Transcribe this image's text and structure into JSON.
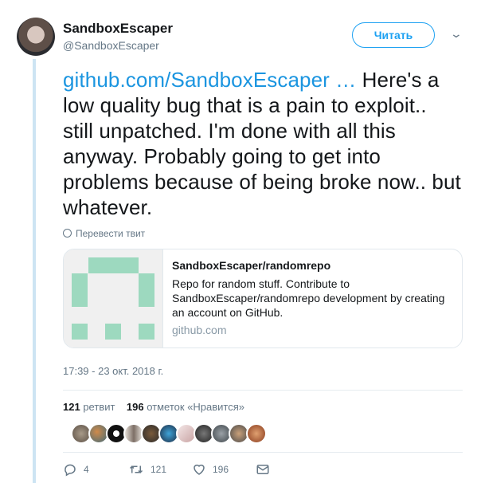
{
  "author": {
    "display_name": "SandboxEscaper",
    "handle": "@SandboxEscaper"
  },
  "follow_label": "Читать",
  "tweet": {
    "link_text": "github.com/SandboxEscaper …",
    "body": " Here's a low quality bug that is a pain to exploit.. still unpatched. I'm done with all this anyway. Probably going to get into problems because of being broke now.. but whatever.",
    "translate_label": "Перевести твит"
  },
  "card": {
    "title": "SandboxEscaper/randomrepo",
    "description": "Repo for random stuff. Contribute to SandboxEscaper/randomrepo development by creating an account on GitHub.",
    "domain": "github.com"
  },
  "timestamp": "17:39 - 23 окт. 2018 г.",
  "stats": {
    "retweets_count": "121",
    "retweets_label": "ретвит",
    "likes_count": "196",
    "likes_label": "отметок «Нравится»"
  },
  "actions": {
    "replies": "4",
    "retweets": "121",
    "likes": "196"
  },
  "colors": {
    "accent": "#1da1f2",
    "link": "#1b95e0",
    "identicon": "#9dd9bf"
  }
}
